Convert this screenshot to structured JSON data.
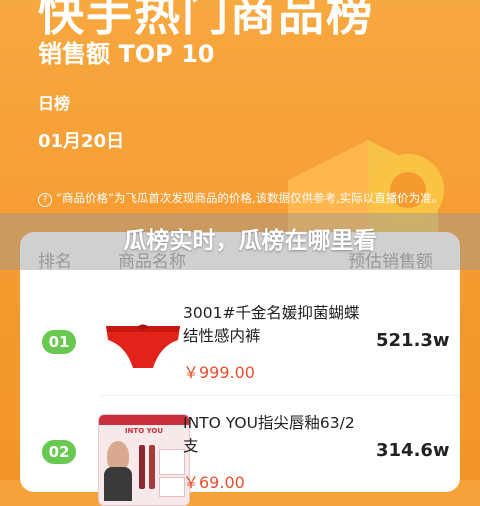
{
  "header": {
    "title": "快手热门商品榜",
    "subtitle": "销售额 TOP 10",
    "period": "日榜",
    "date": "01月20日",
    "note": "“商品价格”为飞瓜首次发现商品的价格,该数据仅供参考,实际以直播价为准。",
    "help_symbol": "?"
  },
  "overlay": {
    "title": "瓜榜实时，瓜榜在哪里看"
  },
  "table": {
    "columns": [
      "排名",
      "商品名称",
      "预估销售额"
    ],
    "rows": [
      {
        "rank": "01",
        "name": "3001#千金名媛抑菌蝴蝶结性感内裤",
        "price": "￥999.00",
        "sales": "521.3w",
        "thumb_label": ""
      },
      {
        "rank": "02",
        "name": "INTO YOU指尖唇釉63/2支",
        "price": "￥69.00",
        "sales": "314.6w",
        "thumb_label": "INTO YOU"
      }
    ]
  },
  "colors": {
    "accent": "#f59a2f",
    "rank_badge": "#69c84f",
    "price": "#e8502b"
  }
}
